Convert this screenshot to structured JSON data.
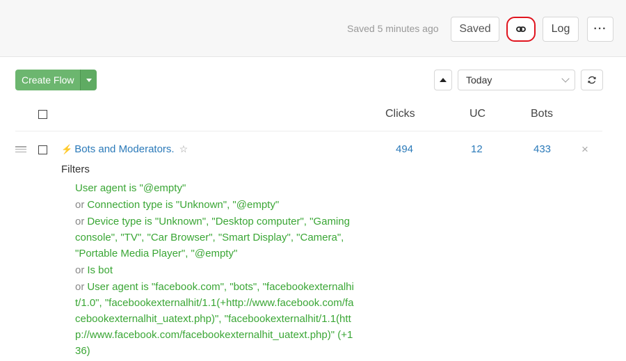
{
  "topbar": {
    "saved_status": "Saved 5 minutes ago",
    "saved_button": "Saved",
    "link_icon": "link-icon",
    "log_button": "Log",
    "more_button": "···"
  },
  "toolbar": {
    "create_flow": "Create Flow",
    "date_range": "Today"
  },
  "table": {
    "columns": [
      "Clicks",
      "UC",
      "Bots"
    ]
  },
  "flow": {
    "name": "Bots and Moderators.",
    "clicks": "494",
    "uc": "12",
    "bots": "433",
    "close": "×",
    "filters_label": "Filters",
    "or_label": "or",
    "filters": [
      "User agent is \"@empty\"",
      "Connection type is \"Unknown\", \"@empty\"",
      "Device type is \"Unknown\", \"Desktop computer\", \"Gaming console\", \"TV\", \"Car Browser\", \"Smart Display\", \"Camera\", \"Portable Media Player\", \"@empty\"",
      "Is bot",
      "User agent is \"facebook.com\", \"bots\", \"facebookexternalhit/1.0\", \"facebookexternalhit/1.1(+http://www.facebook.com/facebookexternalhit_uatext.php)\", \"facebookexternalhit/1.1(http://www.facebook.com/facebookexternalhit_uatext.php)\" (+136)"
    ]
  },
  "colors": {
    "accent_green": "#6cb66f",
    "link_blue": "#2b7ab9",
    "condition_green": "#3aa635",
    "highlight_red": "#e0141e"
  }
}
